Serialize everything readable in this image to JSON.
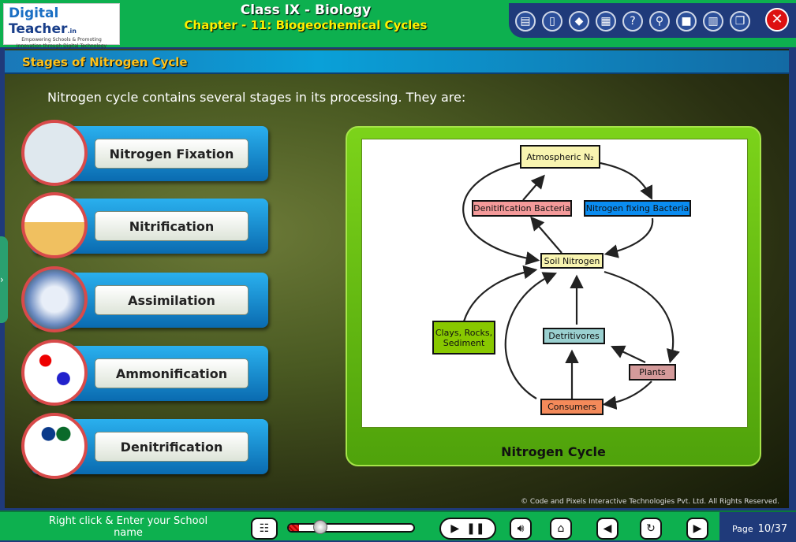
{
  "logo": {
    "brand_a": "Digital",
    "brand_b": "Teacher",
    "brand_c": ".in",
    "tagline1": "Empowering Schools & Promoting",
    "tagline2": "Innovation through Digital Technology"
  },
  "header": {
    "title": "Class IX - Biology",
    "chapter": "Chapter - 11: Biogeochemical Cycles"
  },
  "toolbar": {
    "icons": [
      "notes-icon",
      "book-icon",
      "chart-icon",
      "calendar-icon",
      "help-icon",
      "search-icon",
      "dictionary-icon",
      "library-icon",
      "window-icon"
    ],
    "help": "?",
    "close": "✕"
  },
  "section": {
    "title": "Stages of Nitrogen Cycle",
    "intro": "Nitrogen cycle contains several stages in its processing. They are:"
  },
  "stages": [
    {
      "label": "Nitrogen Fixation"
    },
    {
      "label": "Nitrification"
    },
    {
      "label": "Assimilation"
    },
    {
      "label": "Ammonification"
    },
    {
      "label": "Denitrification"
    }
  ],
  "diagram": {
    "caption": "Nitrogen Cycle",
    "nodes": {
      "atm": "Atmospheric N₂",
      "denit": "Denitification Bacteria",
      "nfix": "Nitrogen fixing Bacteria",
      "soil": "Soil Nitrogen",
      "clays": "Clays, Rocks, Sediment",
      "detr": "Detritivores",
      "plants": "Plants",
      "cons": "Consumers"
    },
    "colors": {
      "atm": "#f8f4b0",
      "denit": "#f49a9a",
      "nfix": "#0a8cf0",
      "soil": "#f8f4b0",
      "clays": "#88c800",
      "detr": "#9ad0d0",
      "plants": "#d49a9a",
      "cons": "#f48a5a"
    }
  },
  "footer": {
    "copyright": "© Code and Pixels Interactive Technologies  Pvt. Ltd. All Rights Reserved.",
    "school": "Right click & Enter your School name",
    "page_label": "Page",
    "page_value": "10/37",
    "progress": 0.08
  }
}
